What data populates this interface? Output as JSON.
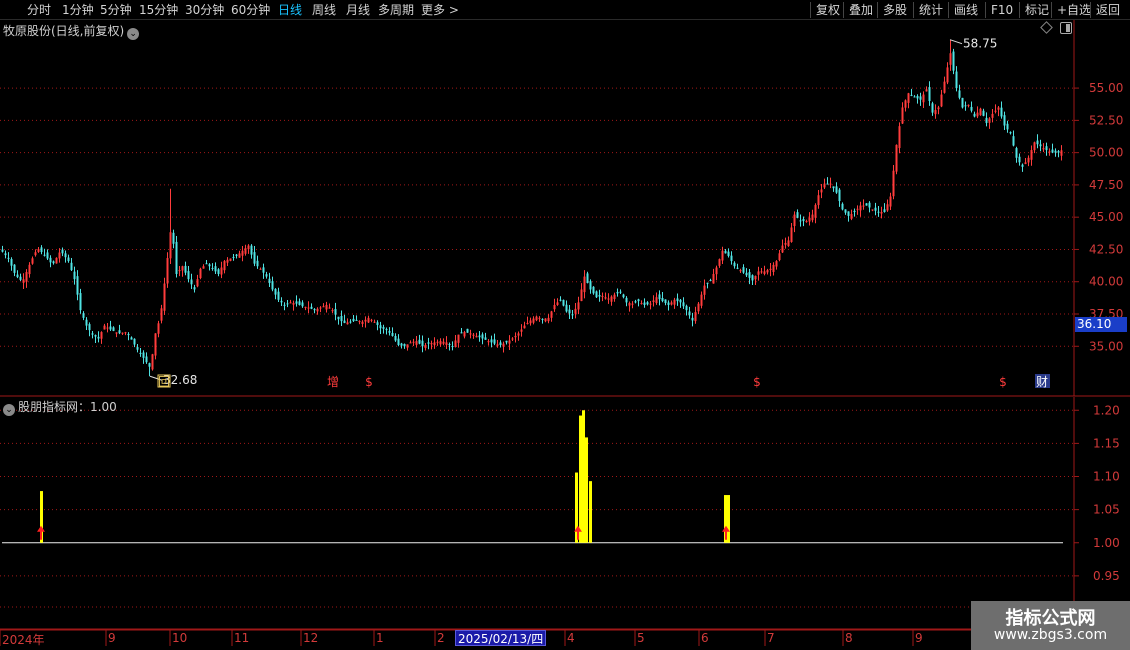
{
  "toolbar": {
    "left": [
      "分时",
      "1分钟",
      "5分钟",
      "15分钟",
      "30分钟",
      "60分钟",
      "日线",
      "周线",
      "月线",
      "多周期",
      "更多 >"
    ],
    "active": "日线",
    "right": [
      "复权",
      "叠加",
      "多股",
      "统计",
      "画线",
      "F10",
      "标记",
      "+自选",
      "返回"
    ]
  },
  "main": {
    "title": "牧原股份(日线,前复权)",
    "title_icon": "chevron-down-icon",
    "price_badge": "36.10",
    "high_label": "58.75",
    "low_label": "32.68",
    "event_markers": [
      "回",
      "增",
      "$",
      "$",
      "$",
      "财"
    ]
  },
  "indicator": {
    "title": "股朋指标网：1.00",
    "title_icon": "chevron-down-icon"
  },
  "date_axis": {
    "labels": [
      "2024年",
      "9",
      "10",
      "11",
      "12",
      "1",
      "2",
      "4",
      "5",
      "6",
      "7",
      "8",
      "9"
    ],
    "cursor": "2025/02/13/四"
  },
  "watermark": {
    "title": "指标公式网",
    "url": "www.zbgs3.com"
  },
  "colors": {
    "up": "#ff3c3c",
    "down": "#4fe3e3",
    "grid": "#a01818",
    "axis": "#d23a3a",
    "signal_bar": "#ffff00",
    "signal_arrow": "#ff2020",
    "active_tab": "#19c3ff"
  },
  "chart_data": [
    {
      "type": "candlestick",
      "title": "牧原股份(日线,前复权)",
      "y_ticks": [
        "55.00",
        "52.50",
        "50.00",
        "47.50",
        "45.00",
        "42.50",
        "40.00",
        "37.50",
        "35.00"
      ],
      "ylim": [
        32.0,
        59.5
      ],
      "grid": true,
      "annotations": {
        "high": 58.75,
        "low": 32.68,
        "last": 36.1
      },
      "close_path": [
        [
          0,
          42.5
        ],
        [
          8,
          41.8
        ],
        [
          15,
          40.5
        ],
        [
          22,
          40.0
        ],
        [
          30,
          41.5
        ],
        [
          37,
          42.6
        ],
        [
          45,
          42.0
        ],
        [
          52,
          41.3
        ],
        [
          60,
          42.4
        ],
        [
          68,
          41.6
        ],
        [
          74,
          40.2
        ],
        [
          80,
          37.8
        ],
        [
          86,
          36.6
        ],
        [
          92,
          35.9
        ],
        [
          98,
          35.6
        ],
        [
          104,
          36.6
        ],
        [
          110,
          36.3
        ],
        [
          118,
          36.0
        ],
        [
          126,
          36.1
        ],
        [
          132,
          35.4
        ],
        [
          138,
          34.6
        ],
        [
          144,
          34.0
        ],
        [
          150,
          33.3
        ],
        [
          155,
          36.0
        ],
        [
          160,
          37.3
        ],
        [
          165,
          40.5
        ],
        [
          171,
          44.5
        ],
        [
          176,
          40.6
        ],
        [
          182,
          41.2
        ],
        [
          188,
          40.2
        ],
        [
          194,
          39.4
        ],
        [
          200,
          41.0
        ],
        [
          206,
          41.4
        ],
        [
          212,
          41.0
        ],
        [
          218,
          40.6
        ],
        [
          224,
          41.6
        ],
        [
          230,
          41.8
        ],
        [
          236,
          42.0
        ],
        [
          242,
          42.4
        ],
        [
          248,
          42.8
        ],
        [
          254,
          41.4
        ],
        [
          260,
          41.0
        ],
        [
          266,
          40.4
        ],
        [
          272,
          39.4
        ],
        [
          278,
          38.6
        ],
        [
          284,
          38.2
        ],
        [
          290,
          38.4
        ],
        [
          296,
          38.3
        ],
        [
          302,
          38.1
        ],
        [
          308,
          38.0
        ],
        [
          314,
          37.8
        ],
        [
          320,
          38.0
        ],
        [
          326,
          38.2
        ],
        [
          332,
          37.8
        ],
        [
          338,
          37.1
        ],
        [
          344,
          36.8
        ],
        [
          350,
          36.9
        ],
        [
          356,
          37.0
        ],
        [
          362,
          36.9
        ],
        [
          368,
          37.2
        ],
        [
          374,
          36.9
        ],
        [
          380,
          36.4
        ],
        [
          386,
          36.3
        ],
        [
          392,
          35.8
        ],
        [
          398,
          35.1
        ],
        [
          404,
          35.0
        ],
        [
          410,
          35.3
        ],
        [
          416,
          35.4
        ],
        [
          422,
          35.0
        ],
        [
          428,
          35.2
        ],
        [
          434,
          35.3
        ],
        [
          440,
          35.4
        ],
        [
          446,
          35.3
        ],
        [
          452,
          35.0
        ],
        [
          458,
          35.9
        ],
        [
          464,
          36.1
        ],
        [
          470,
          36.0
        ],
        [
          476,
          35.8
        ],
        [
          482,
          35.6
        ],
        [
          488,
          35.4
        ],
        [
          494,
          35.2
        ],
        [
          500,
          35.1
        ],
        [
          506,
          35.3
        ],
        [
          512,
          35.6
        ],
        [
          518,
          36.0
        ],
        [
          524,
          36.6
        ],
        [
          530,
          37.0
        ],
        [
          536,
          37.3
        ],
        [
          542,
          37.1
        ],
        [
          548,
          37.2
        ],
        [
          554,
          38.2
        ],
        [
          560,
          38.6
        ],
        [
          566,
          37.7
        ],
        [
          572,
          37.4
        ],
        [
          578,
          38.4
        ],
        [
          584,
          40.4
        ],
        [
          590,
          39.4
        ],
        [
          596,
          38.8
        ],
        [
          602,
          38.9
        ],
        [
          608,
          38.7
        ],
        [
          614,
          39.0
        ],
        [
          620,
          39.2
        ],
        [
          626,
          38.4
        ],
        [
          632,
          38.3
        ],
        [
          638,
          38.5
        ],
        [
          644,
          38.2
        ],
        [
          650,
          38.3
        ],
        [
          656,
          38.8
        ],
        [
          662,
          38.5
        ],
        [
          668,
          38.2
        ],
        [
          674,
          38.6
        ],
        [
          680,
          38.4
        ],
        [
          686,
          37.8
        ],
        [
          692,
          37.0
        ],
        [
          698,
          38.3
        ],
        [
          704,
          39.7
        ],
        [
          710,
          40.1
        ],
        [
          716,
          41.1
        ],
        [
          722,
          42.4
        ],
        [
          728,
          42.0
        ],
        [
          734,
          41.2
        ],
        [
          740,
          40.9
        ],
        [
          746,
          40.5
        ],
        [
          752,
          40.1
        ],
        [
          758,
          40.8
        ],
        [
          764,
          40.8
        ],
        [
          770,
          41.0
        ],
        [
          776,
          41.6
        ],
        [
          782,
          42.8
        ],
        [
          788,
          43.2
        ],
        [
          794,
          45.2
        ],
        [
          800,
          44.7
        ],
        [
          806,
          44.7
        ],
        [
          812,
          45.2
        ],
        [
          818,
          46.7
        ],
        [
          824,
          47.6
        ],
        [
          830,
          47.6
        ],
        [
          836,
          46.9
        ],
        [
          842,
          45.6
        ],
        [
          848,
          45.1
        ],
        [
          854,
          45.4
        ],
        [
          860,
          45.9
        ],
        [
          866,
          45.9
        ],
        [
          872,
          45.6
        ],
        [
          878,
          45.4
        ],
        [
          884,
          45.4
        ],
        [
          890,
          46.6
        ],
        [
          896,
          50.6
        ],
        [
          902,
          53.5
        ],
        [
          908,
          54.6
        ],
        [
          914,
          54.3
        ],
        [
          920,
          54.1
        ],
        [
          926,
          54.9
        ],
        [
          932,
          53.1
        ],
        [
          938,
          53.5
        ],
        [
          944,
          55.5
        ],
        [
          950,
          57.7
        ],
        [
          956,
          55.0
        ],
        [
          962,
          53.5
        ],
        [
          968,
          53.7
        ],
        [
          974,
          52.8
        ],
        [
          980,
          53.4
        ],
        [
          986,
          52.3
        ],
        [
          992,
          53.0
        ],
        [
          998,
          53.5
        ],
        [
          1004,
          52.1
        ],
        [
          1010,
          51.5
        ],
        [
          1016,
          49.6
        ],
        [
          1022,
          48.9
        ],
        [
          1028,
          49.6
        ],
        [
          1034,
          50.8
        ],
        [
          1040,
          50.5
        ],
        [
          1046,
          50.2
        ],
        [
          1052,
          50.0
        ],
        [
          1058,
          50.0
        ],
        [
          1063,
          50.3
        ]
      ]
    },
    {
      "type": "bar",
      "title": "股朋指标网",
      "y_ticks": [
        "1.20",
        "1.15",
        "1.10",
        "1.05",
        "1.00",
        "0.95"
      ],
      "ylim": [
        0.9,
        1.22
      ],
      "baseline": 1.0,
      "bars": [
        {
          "day": 41,
          "value": 1.078
        },
        {
          "day": 576,
          "value": 1.106
        },
        {
          "day": 580,
          "value": 1.192
        },
        {
          "day": 583,
          "value": 1.2
        },
        {
          "day": 586,
          "value": 1.159
        },
        {
          "day": 590,
          "value": 1.093
        },
        {
          "day": 725,
          "value": 1.072
        },
        {
          "day": 728,
          "value": 1.072
        }
      ],
      "signal_arrows": [
        41,
        578,
        726
      ]
    }
  ]
}
